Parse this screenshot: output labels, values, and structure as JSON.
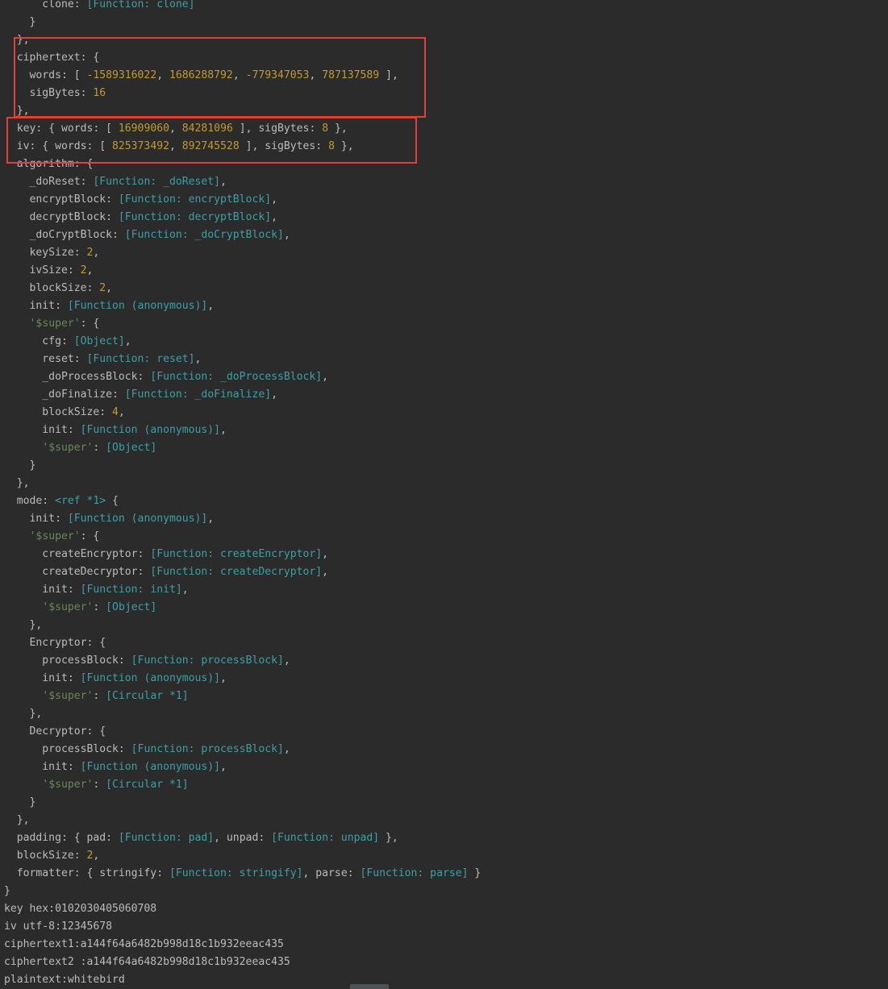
{
  "colors": {
    "background": "#2b2b2b",
    "text": "#bbbbbb",
    "number": "#c29a2e",
    "function": "#3d9fa5",
    "string": "#6a8759",
    "highlight_box": "#e0403a"
  },
  "console": {
    "lines": [
      [
        [
          "p",
          "      clone: "
        ],
        [
          "f",
          "[Function: clone]"
        ]
      ],
      [
        [
          "p",
          "    }"
        ]
      ],
      [
        [
          "p",
          "  },"
        ]
      ],
      [
        [
          "p",
          "  ciphertext: {"
        ]
      ],
      [
        [
          "p",
          "    words: [ "
        ],
        [
          "n",
          "-1589316022"
        ],
        [
          "p",
          ", "
        ],
        [
          "n",
          "1686288792"
        ],
        [
          "p",
          ", "
        ],
        [
          "n",
          "-779347053"
        ],
        [
          "p",
          ", "
        ],
        [
          "n",
          "787137589"
        ],
        [
          "p",
          " ],"
        ]
      ],
      [
        [
          "p",
          "    sigBytes: "
        ],
        [
          "n",
          "16"
        ]
      ],
      [
        [
          "p",
          "  },"
        ]
      ],
      [
        [
          "p",
          "  key: { words: [ "
        ],
        [
          "n",
          "16909060"
        ],
        [
          "p",
          ", "
        ],
        [
          "n",
          "84281096"
        ],
        [
          "p",
          " ], sigBytes: "
        ],
        [
          "n",
          "8"
        ],
        [
          "p",
          " },"
        ]
      ],
      [
        [
          "p",
          "  iv: { words: [ "
        ],
        [
          "n",
          "825373492"
        ],
        [
          "p",
          ", "
        ],
        [
          "n",
          "892745528"
        ],
        [
          "p",
          " ], sigBytes: "
        ],
        [
          "n",
          "8"
        ],
        [
          "p",
          " },"
        ]
      ],
      [
        [
          "p",
          "  algorithm: {"
        ]
      ],
      [
        [
          "p",
          "    _doReset: "
        ],
        [
          "f",
          "[Function: _doReset]"
        ],
        [
          "p",
          ","
        ]
      ],
      [
        [
          "p",
          "    encryptBlock: "
        ],
        [
          "f",
          "[Function: encryptBlock]"
        ],
        [
          "p",
          ","
        ]
      ],
      [
        [
          "p",
          "    decryptBlock: "
        ],
        [
          "f",
          "[Function: decryptBlock]"
        ],
        [
          "p",
          ","
        ]
      ],
      [
        [
          "p",
          "    _doCryptBlock: "
        ],
        [
          "f",
          "[Function: _doCryptBlock]"
        ],
        [
          "p",
          ","
        ]
      ],
      [
        [
          "p",
          "    keySize: "
        ],
        [
          "n",
          "2"
        ],
        [
          "p",
          ","
        ]
      ],
      [
        [
          "p",
          "    ivSize: "
        ],
        [
          "n",
          "2"
        ],
        [
          "p",
          ","
        ]
      ],
      [
        [
          "p",
          "    blockSize: "
        ],
        [
          "n",
          "2"
        ],
        [
          "p",
          ","
        ]
      ],
      [
        [
          "p",
          "    init: "
        ],
        [
          "f",
          "[Function (anonymous)]"
        ],
        [
          "p",
          ","
        ]
      ],
      [
        [
          "p",
          "    "
        ],
        [
          "s",
          "'$super'"
        ],
        [
          "p",
          ": {"
        ]
      ],
      [
        [
          "p",
          "      cfg: "
        ],
        [
          "f",
          "[Object]"
        ],
        [
          "p",
          ","
        ]
      ],
      [
        [
          "p",
          "      reset: "
        ],
        [
          "f",
          "[Function: reset]"
        ],
        [
          "p",
          ","
        ]
      ],
      [
        [
          "p",
          "      _doProcessBlock: "
        ],
        [
          "f",
          "[Function: _doProcessBlock]"
        ],
        [
          "p",
          ","
        ]
      ],
      [
        [
          "p",
          "      _doFinalize: "
        ],
        [
          "f",
          "[Function: _doFinalize]"
        ],
        [
          "p",
          ","
        ]
      ],
      [
        [
          "p",
          "      blockSize: "
        ],
        [
          "n",
          "4"
        ],
        [
          "p",
          ","
        ]
      ],
      [
        [
          "p",
          "      init: "
        ],
        [
          "f",
          "[Function (anonymous)]"
        ],
        [
          "p",
          ","
        ]
      ],
      [
        [
          "p",
          "      "
        ],
        [
          "s",
          "'$super'"
        ],
        [
          "p",
          ": "
        ],
        [
          "f",
          "[Object]"
        ]
      ],
      [
        [
          "p",
          "    }"
        ]
      ],
      [
        [
          "p",
          "  },"
        ]
      ],
      [
        [
          "p",
          "  mode: "
        ],
        [
          "f",
          "<ref *1>"
        ],
        [
          "p",
          " {"
        ]
      ],
      [
        [
          "p",
          "    init: "
        ],
        [
          "f",
          "[Function (anonymous)]"
        ],
        [
          "p",
          ","
        ]
      ],
      [
        [
          "p",
          "    "
        ],
        [
          "s",
          "'$super'"
        ],
        [
          "p",
          ": {"
        ]
      ],
      [
        [
          "p",
          "      createEncryptor: "
        ],
        [
          "f",
          "[Function: createEncryptor]"
        ],
        [
          "p",
          ","
        ]
      ],
      [
        [
          "p",
          "      createDecryptor: "
        ],
        [
          "f",
          "[Function: createDecryptor]"
        ],
        [
          "p",
          ","
        ]
      ],
      [
        [
          "p",
          "      init: "
        ],
        [
          "f",
          "[Function: init]"
        ],
        [
          "p",
          ","
        ]
      ],
      [
        [
          "p",
          "      "
        ],
        [
          "s",
          "'$super'"
        ],
        [
          "p",
          ": "
        ],
        [
          "f",
          "[Object]"
        ]
      ],
      [
        [
          "p",
          "    },"
        ]
      ],
      [
        [
          "p",
          "    Encryptor: {"
        ]
      ],
      [
        [
          "p",
          "      processBlock: "
        ],
        [
          "f",
          "[Function: processBlock]"
        ],
        [
          "p",
          ","
        ]
      ],
      [
        [
          "p",
          "      init: "
        ],
        [
          "f",
          "[Function (anonymous)]"
        ],
        [
          "p",
          ","
        ]
      ],
      [
        [
          "p",
          "      "
        ],
        [
          "s",
          "'$super'"
        ],
        [
          "p",
          ": "
        ],
        [
          "f",
          "[Circular *1]"
        ]
      ],
      [
        [
          "p",
          "    },"
        ]
      ],
      [
        [
          "p",
          "    Decryptor: {"
        ]
      ],
      [
        [
          "p",
          "      processBlock: "
        ],
        [
          "f",
          "[Function: processBlock]"
        ],
        [
          "p",
          ","
        ]
      ],
      [
        [
          "p",
          "      init: "
        ],
        [
          "f",
          "[Function (anonymous)]"
        ],
        [
          "p",
          ","
        ]
      ],
      [
        [
          "p",
          "      "
        ],
        [
          "s",
          "'$super'"
        ],
        [
          "p",
          ": "
        ],
        [
          "f",
          "[Circular *1]"
        ]
      ],
      [
        [
          "p",
          "    }"
        ]
      ],
      [
        [
          "p",
          "  },"
        ]
      ],
      [
        [
          "p",
          "  padding: { pad: "
        ],
        [
          "f",
          "[Function: pad]"
        ],
        [
          "p",
          ", unpad: "
        ],
        [
          "f",
          "[Function: unpad]"
        ],
        [
          "p",
          " },"
        ]
      ],
      [
        [
          "p",
          "  blockSize: "
        ],
        [
          "n",
          "2"
        ],
        [
          "p",
          ","
        ]
      ],
      [
        [
          "p",
          "  formatter: { stringify: "
        ],
        [
          "f",
          "[Function: stringify]"
        ],
        [
          "p",
          ", parse: "
        ],
        [
          "f",
          "[Function: parse]"
        ],
        [
          "p",
          " }"
        ]
      ],
      [
        [
          "p",
          "}"
        ]
      ],
      [
        [
          "p",
          "key hex:0102030405060708"
        ]
      ],
      [
        [
          "p",
          "iv utf-8:12345678"
        ]
      ],
      [
        [
          "p",
          "ciphertext1:a144f64a6482b998d18c1b932eeac435"
        ]
      ],
      [
        [
          "p",
          "ciphertext2 :a144f64a6482b998d18c1b932eeac435"
        ]
      ],
      [
        [
          "p",
          "plaintext:whitebird"
        ]
      ]
    ]
  }
}
